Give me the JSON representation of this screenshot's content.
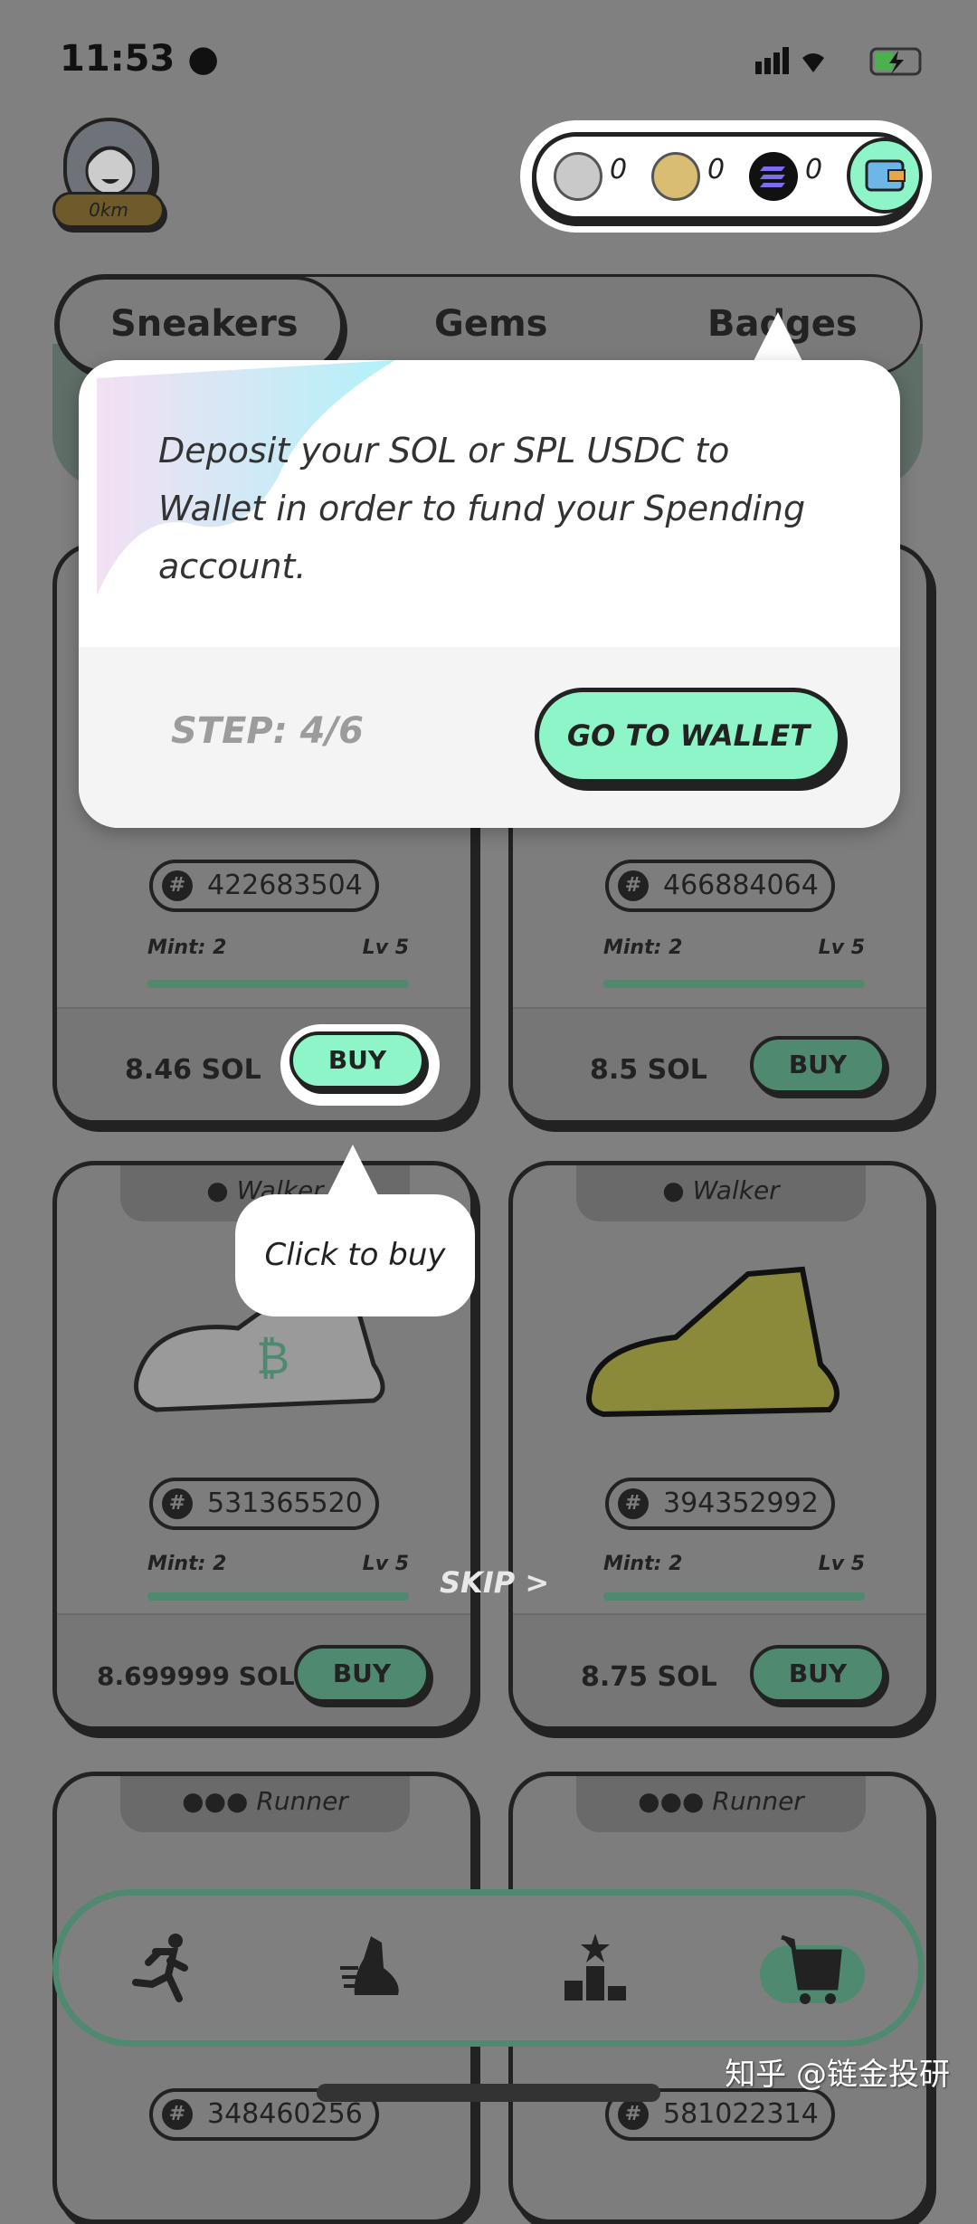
{
  "status_bar": {
    "time": "11:53"
  },
  "profile": {
    "distance": "0km"
  },
  "balances": [
    {
      "icon": "gst-sneaker-coin-icon",
      "value": "0"
    },
    {
      "icon": "gmt-coin-icon",
      "value": "0"
    },
    {
      "icon": "sol-coin-icon",
      "value": "0"
    }
  ],
  "tabs": [
    {
      "label": "Sneakers",
      "active": true
    },
    {
      "label": "Gems"
    },
    {
      "label": "Badges"
    }
  ],
  "tutorial": {
    "text": "Deposit your SOL or SPL USDC to Wallet in order to fund your Spending account.",
    "step": "STEP: 4/6",
    "button": "GO TO WALLET",
    "buy_hint": "Click to buy",
    "skip": "SKIP >"
  },
  "listings": [
    {
      "category": "",
      "id": "422683504",
      "mint": "Mint: 2",
      "level": "Lv 5",
      "price": "8.46 SOL",
      "buy": "BUY"
    },
    {
      "category": "",
      "id": "466884064",
      "mint": "Mint: 2",
      "level": "Lv 5",
      "price": "8.5 SOL",
      "buy": "BUY"
    },
    {
      "category": "Walker",
      "id": "531365520",
      "mint": "Mint: 2",
      "level": "Lv 5",
      "price": "8.699999 SOL",
      "buy": "BUY"
    },
    {
      "category": "Walker",
      "id": "394352992",
      "mint": "Mint: 2",
      "level": "Lv 5",
      "price": "8.75 SOL",
      "buy": "BUY"
    },
    {
      "category": "Runner",
      "id": "348460256"
    },
    {
      "category": "Runner",
      "id": "581022314"
    }
  ],
  "colors": {
    "accent": "#8ef5c8",
    "accent_dim": "#4f8a70",
    "overlay": "#808080"
  },
  "watermark": "知乎 @链金投研"
}
